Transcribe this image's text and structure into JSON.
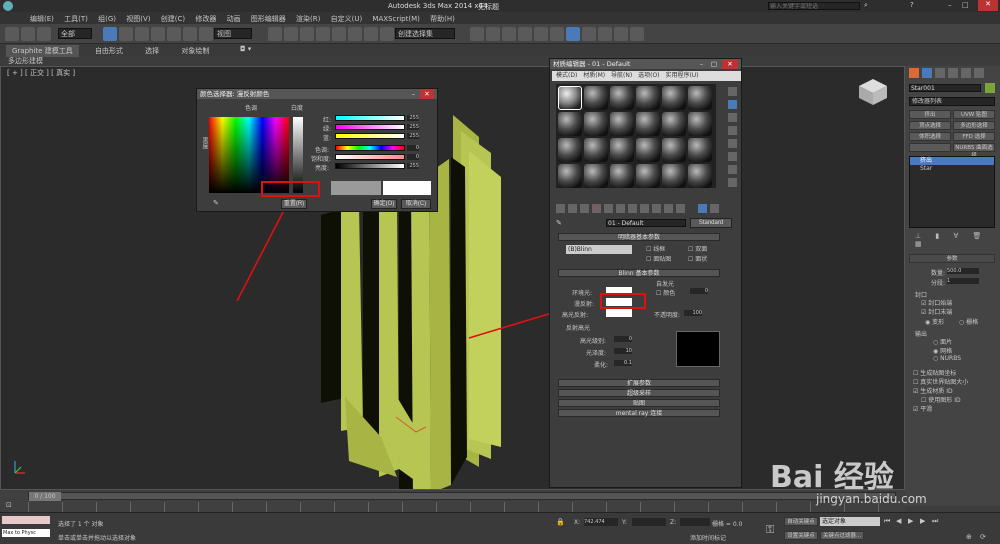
{
  "app": {
    "title": "Autodesk 3ds Max  2014 x64",
    "doc_title": "无标题",
    "search_placeholder": "输入关键字或短语"
  },
  "menu": [
    "编辑(E)",
    "工具(T)",
    "组(G)",
    "视图(V)",
    "创建(C)",
    "修改器",
    "动画",
    "图形编辑器",
    "渲染(R)",
    "自定义(U)",
    "MAXScript(M)",
    "帮助(H)"
  ],
  "toolbar": {
    "selection_filter": "全部",
    "view_dropdown": "视图",
    "named_selection": "创建选择集"
  },
  "ribbon": {
    "tabs": [
      "Graphite 建模工具",
      "自由形式",
      "选择",
      "对象绘制"
    ],
    "sub_label": "多边形建模"
  },
  "viewport": {
    "label": "[ + ] [ 正交 ] [ 真实 ]",
    "colors": {
      "shape": "#b7c552",
      "dark": "#0e1006"
    }
  },
  "color_selector": {
    "title": "颜色选择器: 漫反射颜色",
    "hue_label": "色调",
    "white_label": "白度",
    "black_label": "黑度",
    "channels": [
      {
        "label": "红:",
        "value": "255"
      },
      {
        "label": "绿:",
        "value": "255"
      },
      {
        "label": "蓝:",
        "value": "255"
      },
      {
        "label": "色调:",
        "value": "0"
      },
      {
        "label": "饱和度:",
        "value": "0"
      },
      {
        "label": "亮度:",
        "value": "255"
      }
    ],
    "reset": "重置(R)",
    "ok": "确定(O)",
    "cancel": "取消(C)"
  },
  "material_editor": {
    "title": "材质编辑器 - 01 - Default",
    "menu": [
      "模式(D)",
      "材质(M)",
      "导航(N)",
      "选项(O)",
      "实用程序(U)"
    ],
    "material_name": "01 - Default",
    "material_type": "Standard",
    "shader_rollout": "明暗器基本参数",
    "shader_type": "(B)Blinn",
    "shader_options": [
      "线框",
      "双面",
      "面贴图",
      "面状"
    ],
    "blinn_rollout": "Blinn 基本参数",
    "self_illum_group": "自发光",
    "color_check_label": "颜色",
    "self_illum_value": "0",
    "ambient_label": "环境光:",
    "diffuse_label": "漫反射:",
    "specular_label": "高光反射:",
    "opacity_label": "不透明度:",
    "opacity_value": "100",
    "spec_group": "反射高光",
    "spec_level_label": "高光级别:",
    "spec_level_value": "0",
    "gloss_label": "光泽度:",
    "gloss_value": "10",
    "soften_label": "柔化:",
    "soften_value": "0.1",
    "extra_rollouts": [
      "扩展参数",
      "超级采样",
      "贴图",
      "mental ray 连接"
    ]
  },
  "right_panel": {
    "object_name": "Star001",
    "object_color": "#7aa53a",
    "modifier_list": "修改器列表",
    "mod_buttons": [
      "挤出",
      "UVW 贴图",
      "顶点选择",
      "多边形选择",
      "体积选择",
      "FFD 选择",
      "",
      "NURBS 曲面选择"
    ],
    "stack": [
      "挤出",
      "Star"
    ],
    "params_title": "参数",
    "amount_label": "数量:",
    "amount_value": "500.0",
    "segments_label": "分段:",
    "segments_value": "1",
    "capping_title": "封口",
    "cap_start": "封口始端",
    "cap_end": "封口末端",
    "morph": "变形",
    "grid": "栅格",
    "output_title": "输出",
    "output_opts": [
      "面片",
      "网格",
      "NURBS"
    ],
    "checks": [
      "生成贴图坐标",
      "真实世界贴图大小",
      "生成材质 ID",
      "使用图形 ID",
      "平滑"
    ]
  },
  "timeline": {
    "counter": "0 / 100"
  },
  "status": {
    "script_text": "Max to Physc",
    "selected": "选择了 1 个 对象",
    "hint": "单击或单击并拖动以选择对象",
    "x_label": "X:",
    "x_value": "742.474",
    "y_label": "Y:",
    "z_label": "Z:",
    "grid_label": "栅格 = 0.0",
    "autokey": "自动关键点",
    "selected_obj": "选定对象",
    "setkey": "设置关键点",
    "key_filter": "关键点过滤器...",
    "add_time_tag": "添加时间标记"
  },
  "watermark": {
    "brand": "Bai 经验",
    "url": "jingyan.baidu.com"
  }
}
